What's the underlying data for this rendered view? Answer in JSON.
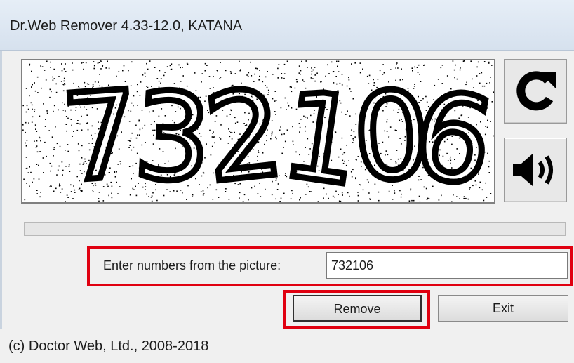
{
  "window": {
    "title": "Dr.Web Remover 4.33-12.0, KATANA"
  },
  "captcha": {
    "digits": "732106",
    "refresh_icon": "refresh-icon",
    "audio_icon": "speaker-icon"
  },
  "progress": {
    "value": 0
  },
  "form": {
    "prompt_label": "Enter numbers from the picture:",
    "answer_value": "732106"
  },
  "buttons": {
    "remove_label": "Remove",
    "exit_label": "Exit"
  },
  "status": {
    "copyright": "(c) Doctor Web, Ltd., 2008-2018"
  },
  "colors": {
    "highlight": "#e00010",
    "progress_fill": "#06b025"
  }
}
